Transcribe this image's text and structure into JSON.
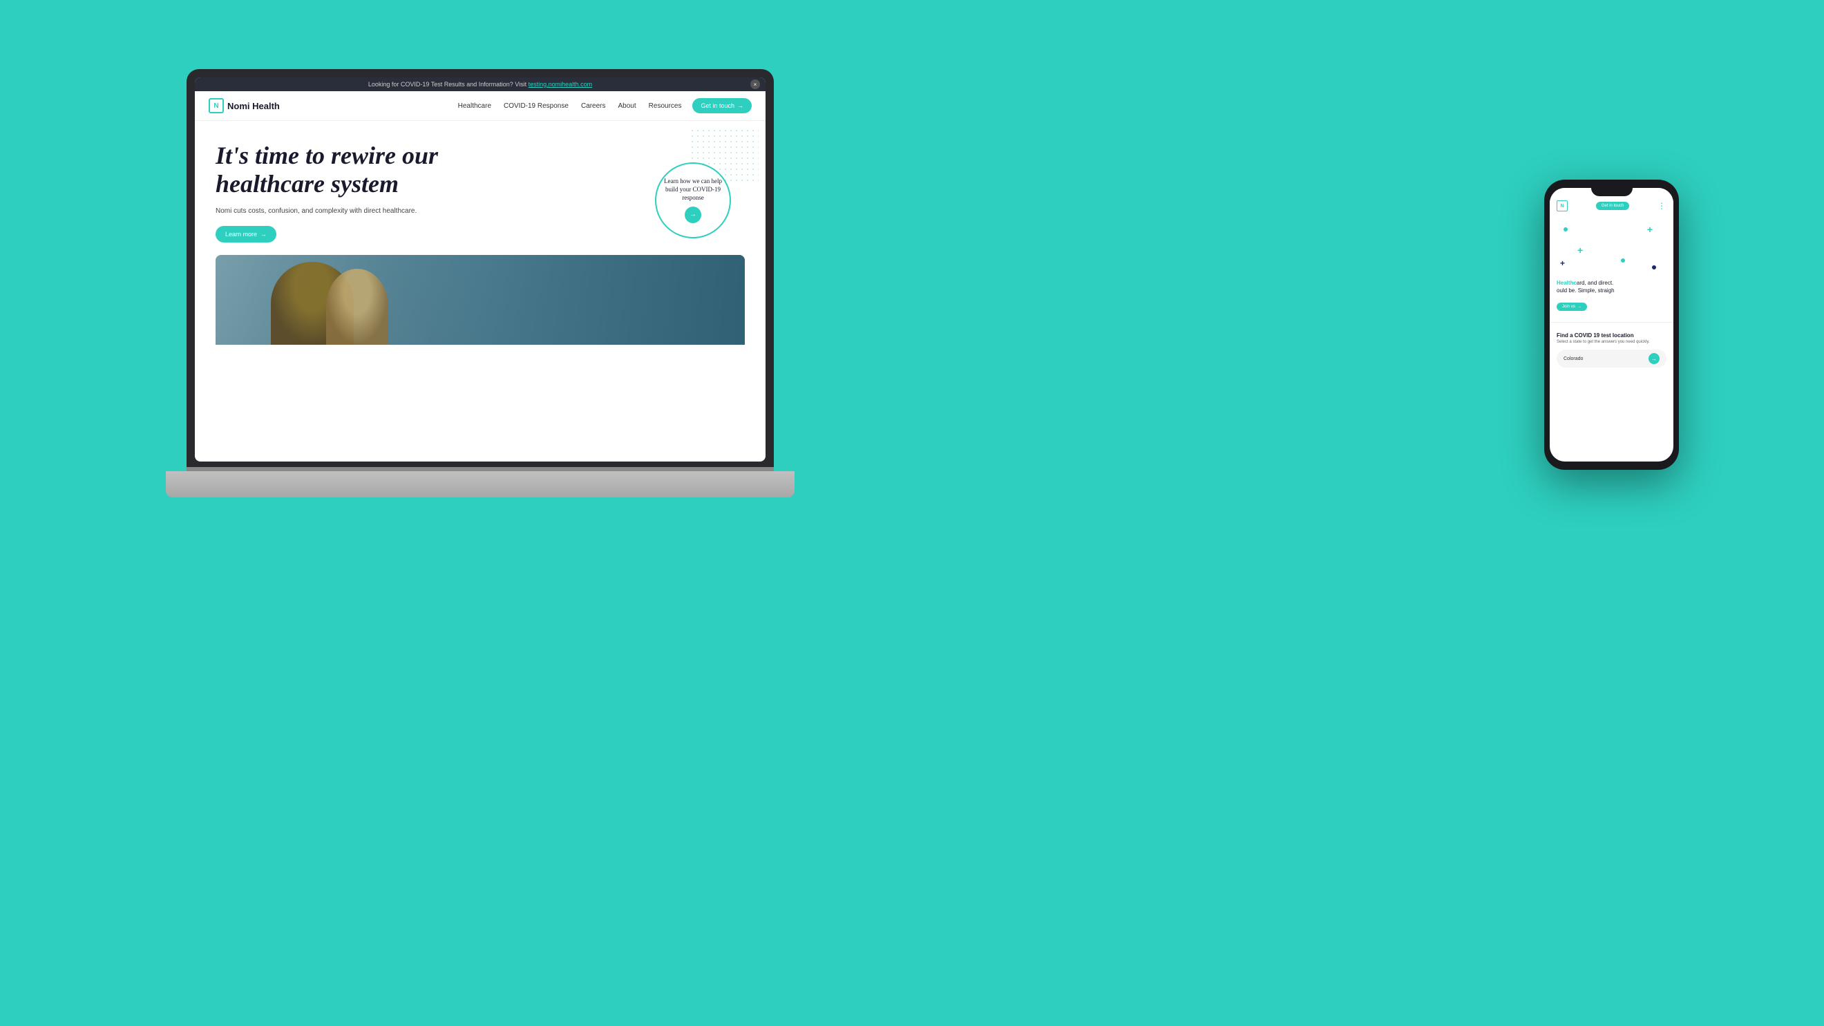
{
  "scene": {
    "bg_color": "#2ECFBF"
  },
  "notif_bar": {
    "text": "Looking for COVID-19 Test Results and Information? Visit testing.nomihealth.com",
    "link_text": "testing.nomihealth.com",
    "close_label": "×"
  },
  "nav": {
    "logo_letter": "N",
    "logo_name": "Nomi Health",
    "links": [
      "Healthcare",
      "COVID-19 Response",
      "Careers",
      "About",
      "Resources"
    ],
    "cta_label": "Get in touch",
    "cta_arrow": "→"
  },
  "hero": {
    "title": "It's time to rewire our healthcare system",
    "subtitle": "Nomi cuts costs, confusion, and complexity with direct healthcare.",
    "learn_more_label": "Learn more",
    "learn_more_arrow": "→"
  },
  "covid_circle": {
    "text": "Learn how we can help build your COVID-19 response",
    "arrow": "→"
  },
  "phone": {
    "logo_letter": "N",
    "nav_btn_label": "Get in touch",
    "menu_dots": "⋮",
    "tagline_black": "ard, and direct.",
    "tagline_teal": "Healthc",
    "tagline_black2": "ould be. Simple, straigh",
    "join_btn_label": "Join us",
    "join_btn_arrow": "→",
    "covid_title": "Find a COVID 19 test location",
    "covid_sub": "Select a state to get the answers you need quickly.",
    "state_value": "Colorado",
    "state_arrow": "→"
  }
}
